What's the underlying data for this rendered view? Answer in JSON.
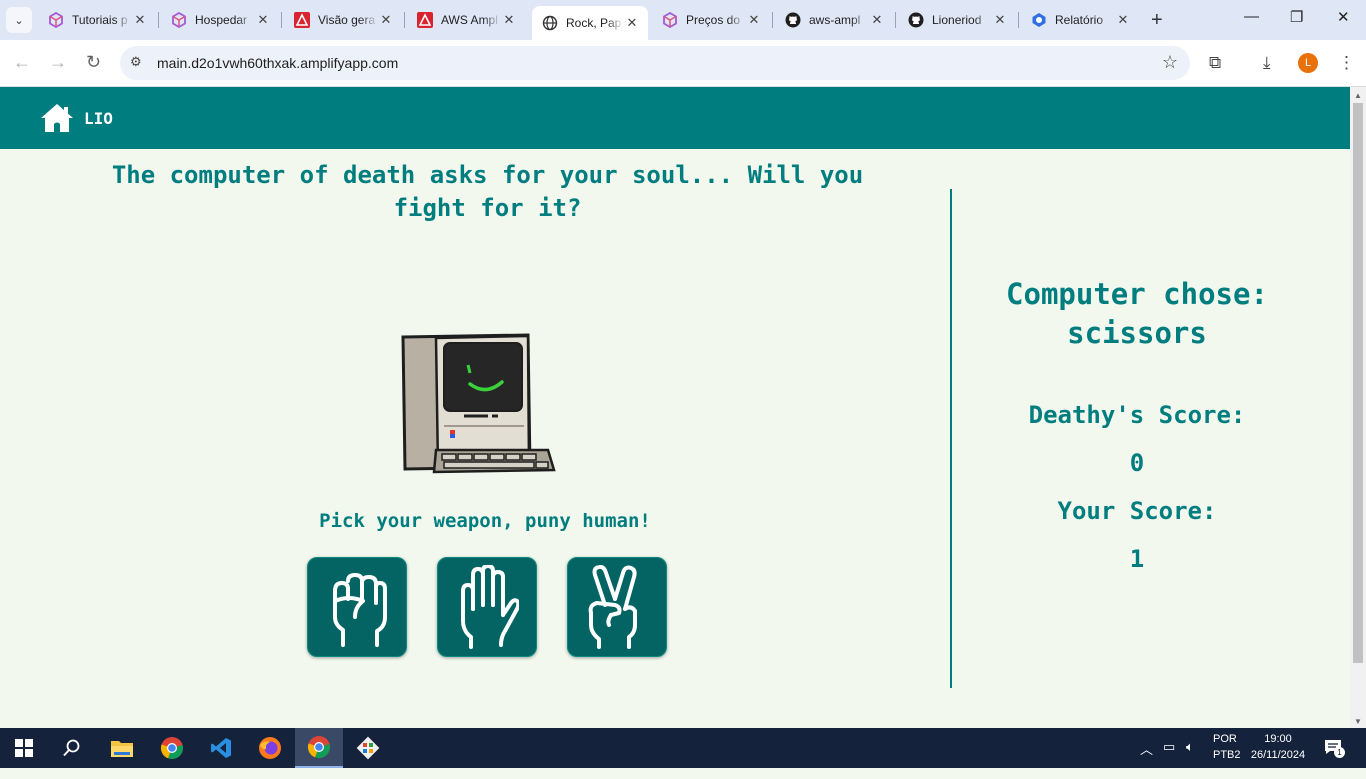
{
  "browser": {
    "tabs": [
      {
        "title": "Tutoriais p",
        "favicon": "amplify-cube-icon",
        "active": false
      },
      {
        "title": "Hospedar",
        "favicon": "amplify-cube-icon",
        "active": false
      },
      {
        "title": "Visão gera",
        "favicon": "aws-amplify-icon",
        "active": false
      },
      {
        "title": "AWS Ampl",
        "favicon": "aws-amplify-icon",
        "active": false
      },
      {
        "title": "Rock, Pap",
        "favicon": "globe-icon",
        "active": true
      },
      {
        "title": "Preços do",
        "favicon": "amplify-cube-icon",
        "active": false
      },
      {
        "title": "aws-ampl",
        "favicon": "github-icon",
        "active": false
      },
      {
        "title": "Lioneriod",
        "favicon": "github-icon",
        "active": false
      },
      {
        "title": "Relatório",
        "favicon": "report-icon",
        "active": false
      }
    ],
    "url": "main.d2o1vwh60thxak.amplifyapp.com",
    "profile_initial": "L",
    "accent": "#dfe6f5"
  },
  "app": {
    "brand": "LIO",
    "header_color": "#007d7f",
    "headline": "The computer of death asks for your soul... Will you fight for it?",
    "pick_prompt": "Pick your weapon, puny human!",
    "weapons": [
      "rock",
      "paper",
      "scissors"
    ],
    "computer_chose_label": "Computer chose:",
    "computer_choice": "scissors",
    "deathy_score_label": "Deathy's Score:",
    "deathy_score": "0",
    "your_score_label": "Your Score:",
    "your_score": "1"
  },
  "taskbar": {
    "apps": [
      "windows-start-icon",
      "search-icon",
      "file-explorer-icon",
      "chrome-icon",
      "vscode-icon",
      "firefox-icon",
      "chrome-icon",
      "git-icon"
    ],
    "language": "POR",
    "layout": "PTB2",
    "time": "19:00",
    "date": "26/11/2024",
    "notifications": "1"
  }
}
